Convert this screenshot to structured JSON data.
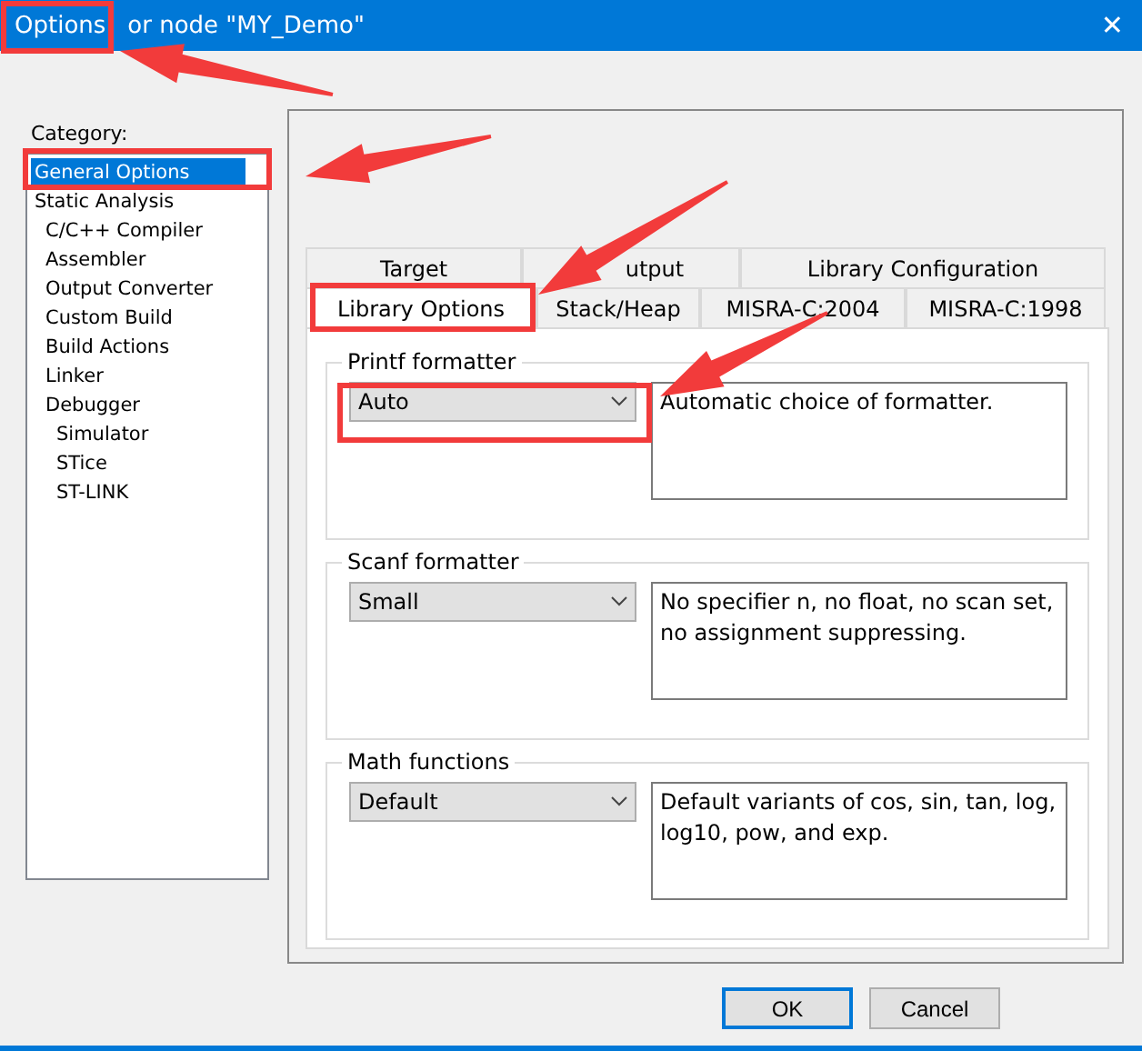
{
  "window": {
    "title_highlighted": "Options",
    "title_rest": "or node \"MY_Demo\"",
    "close": "✕"
  },
  "category": {
    "label": "Category:",
    "items": [
      {
        "label": "General Options",
        "selected": true
      },
      {
        "label": "Static Analysis",
        "selected": false,
        "children": [
          {
            "label": "C/C++ Compiler",
            "selected": false
          },
          {
            "label": "Assembler",
            "selected": false
          },
          {
            "label": "Output Converter",
            "selected": false
          },
          {
            "label": "Custom Build",
            "selected": false
          },
          {
            "label": "Build Actions",
            "selected": false
          },
          {
            "label": "Linker",
            "selected": false
          },
          {
            "label": "Debugger",
            "selected": false,
            "children": [
              {
                "label": "Simulator",
                "selected": false
              },
              {
                "label": "STice",
                "selected": false
              },
              {
                "label": "ST-LINK",
                "selected": false
              }
            ]
          }
        ]
      }
    ]
  },
  "tab_rows": [
    [
      {
        "label": "Target",
        "selected": false
      },
      {
        "label": "utput",
        "selected": false
      },
      {
        "label": "Library Configuration",
        "selected": false
      }
    ],
    [
      {
        "label": "Library Options",
        "selected": true
      },
      {
        "label": "Stack/Heap",
        "selected": false
      },
      {
        "label": "MISRA-C:2004",
        "selected": false
      },
      {
        "label": "MISRA-C:1998",
        "selected": false
      }
    ]
  ],
  "groups": [
    {
      "title": "Printf formatter",
      "value": "Auto",
      "description": "Automatic choice of formatter."
    },
    {
      "title": "Scanf formatter",
      "value": "Small",
      "description": "No specifier n, no float, no scan set, no assignment suppressing."
    },
    {
      "title": "Math functions",
      "value": "Default",
      "description": "Default variants of cos, sin, tan, log, log10, pow, and exp."
    }
  ],
  "buttons": [
    {
      "label": "OK",
      "default": true
    },
    {
      "label": "Cancel",
      "default": false
    }
  ]
}
